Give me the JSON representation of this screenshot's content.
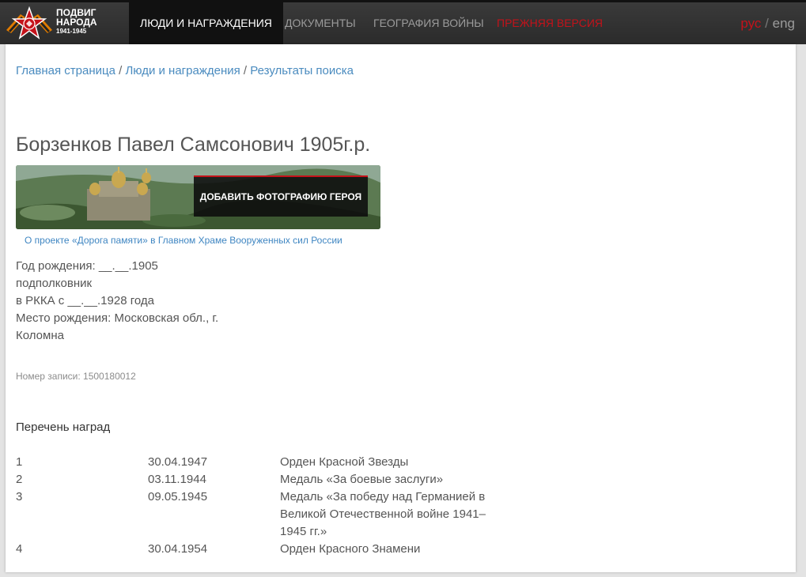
{
  "header": {
    "logo": {
      "line1": "ПОДВИГ",
      "line2": "НАРОДА",
      "years": "1941-1945"
    },
    "nav": {
      "people": "ЛЮДИ И НАГРАЖДЕНИЯ",
      "documents": "ДОКУМЕНТЫ",
      "geography": "ГЕОГРАФИЯ ВОЙНЫ",
      "old_version": "ПРЕЖНЯЯ ВЕРСИЯ"
    },
    "lang": {
      "ru": "рус",
      "sep": "/",
      "en": "eng"
    },
    "colors": {
      "bar": "#2f2f2f",
      "active": "#111111",
      "accent_red": "#c4121a"
    }
  },
  "breadcrumb": {
    "home": "Главная страница",
    "people": "Люди и награждения",
    "results": "Результаты поиска",
    "sep": " / "
  },
  "person": {
    "title": "Борзенков Павел Самсонович 1905г.р.",
    "banner_button": "ДОБАВИТЬ ФОТОГРАФИЮ ГЕРОЯ",
    "banner_caption": "О проекте «Дорога памяти» в Главном Храме Вооруженных сил России",
    "birth_year": "Год рождения: __.__.1905",
    "rank": "подполковник",
    "service": "в РККА с __.__.1928 года",
    "birthplace_line1": "Место рождения: Московская обл., г.",
    "birthplace_line2": "Коломна",
    "record_number": "Номер записи: 1500180012"
  },
  "awards": {
    "title": "Перечень наград",
    "rows": [
      {
        "num": "1",
        "date": "30.04.1947",
        "name": "Орден Красной Звезды"
      },
      {
        "num": "2",
        "date": "03.11.1944",
        "name": "Медаль «За боевые заслуги»"
      },
      {
        "num": "3",
        "date": "09.05.1945",
        "name": "Медаль «За победу над Германией в Великой Отечественной войне 1941–1945 гг.»"
      },
      {
        "num": "4",
        "date": "30.04.1954",
        "name": "Орден Красного Знамени"
      }
    ]
  },
  "icons": {
    "logo": "soviet-star-ribbon-icon"
  }
}
